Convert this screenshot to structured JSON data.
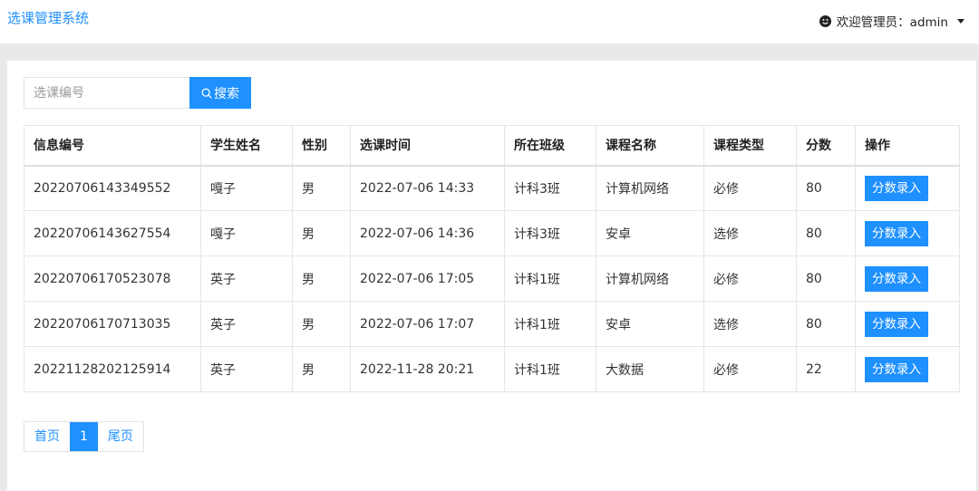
{
  "app": {
    "brand": "选课管理系统",
    "user_menu_label": "欢迎管理员：admin"
  },
  "search": {
    "placeholder": "选课编号",
    "value": "",
    "button_label": "搜索"
  },
  "table": {
    "headers": [
      "信息编号",
      "学生姓名",
      "性别",
      "选课时间",
      "所在班级",
      "课程名称",
      "课程类型",
      "分数",
      "操作"
    ],
    "rows": [
      {
        "id": "20220706143349552",
        "name": "嘎子",
        "gender": "男",
        "time": "2022-07-06 14:33",
        "class": "计科3班",
        "course": "计算机网络",
        "type": "必修",
        "score": "80",
        "action": "分数录入"
      },
      {
        "id": "20220706143627554",
        "name": "嘎子",
        "gender": "男",
        "time": "2022-07-06 14:36",
        "class": "计科3班",
        "course": "安卓",
        "type": "选修",
        "score": "80",
        "action": "分数录入"
      },
      {
        "id": "20220706170523078",
        "name": "英子",
        "gender": "男",
        "time": "2022-07-06 17:05",
        "class": "计科1班",
        "course": "计算机网络",
        "type": "必修",
        "score": "80",
        "action": "分数录入"
      },
      {
        "id": "20220706170713035",
        "name": "英子",
        "gender": "男",
        "time": "2022-07-06 17:07",
        "class": "计科1班",
        "course": "安卓",
        "type": "选修",
        "score": "80",
        "action": "分数录入"
      },
      {
        "id": "20221128202125914",
        "name": "英子",
        "gender": "男",
        "time": "2022-11-28 20:21",
        "class": "计科1班",
        "course": "大数据",
        "type": "必修",
        "score": "22",
        "action": "分数录入"
      }
    ]
  },
  "pagination": {
    "first": "首页",
    "current": "1",
    "last": "尾页"
  },
  "icons": {
    "user": "smile-face-icon",
    "dropdown": "caret-down-icon",
    "search": "search-icon"
  },
  "colors": {
    "accent": "#1e90ff",
    "background": "#e9e9e9"
  }
}
